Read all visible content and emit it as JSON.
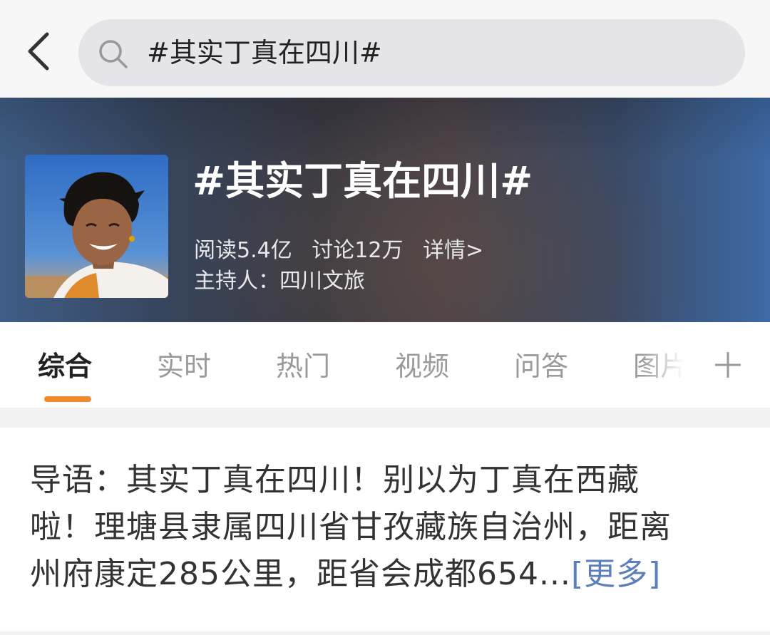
{
  "search": {
    "query": "#其实丁真在四川#"
  },
  "topic": {
    "title": "#其实丁真在四川#",
    "reads": "阅读5.4亿",
    "discussions": "讨论12万",
    "details_link": "详情>",
    "host": "主持人：四川文旅"
  },
  "tabs": [
    {
      "label": "综合",
      "active": true
    },
    {
      "label": "实时"
    },
    {
      "label": "热门"
    },
    {
      "label": "视频"
    },
    {
      "label": "问答"
    },
    {
      "label": "图片"
    }
  ],
  "intro": {
    "line1": "导语：其实丁真在四川！别以为丁真在西藏",
    "line2": "啦！理塘县隶属四川省甘孜藏族自治州，距离",
    "line3": "州府康定285公里，距省会成都654...",
    "more_label": "[更多]"
  },
  "colors": {
    "tab_indicator": "#f0882c",
    "more_link": "#5b7fbd",
    "search_bg": "#e5e5e9"
  },
  "icons": [
    "back-arrow-icon",
    "search-icon",
    "plus-icon"
  ]
}
